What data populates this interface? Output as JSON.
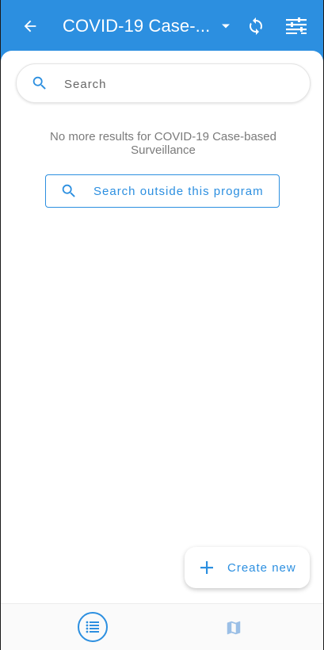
{
  "header": {
    "title": "COVID-19 Case-...",
    "icons": [
      "arrow-back-icon",
      "caret-down-icon",
      "sync-icon",
      "filter-icon"
    ]
  },
  "search": {
    "placeholder": "Search",
    "value": ""
  },
  "results": {
    "empty_message": "No more results for COVID-19 Case-based Surveillance",
    "search_outside_label": "Search outside this program"
  },
  "fab": {
    "label": "Create new"
  },
  "bottom_nav": {
    "items": [
      {
        "icon": "list-icon",
        "selected": true
      },
      {
        "icon": "map-icon",
        "selected": false
      }
    ]
  },
  "colors": {
    "primary": "#2c8fe0",
    "surface": "#ffffff",
    "muted_text": "#7b7b7b",
    "map_icon": "#9bbfe6"
  }
}
